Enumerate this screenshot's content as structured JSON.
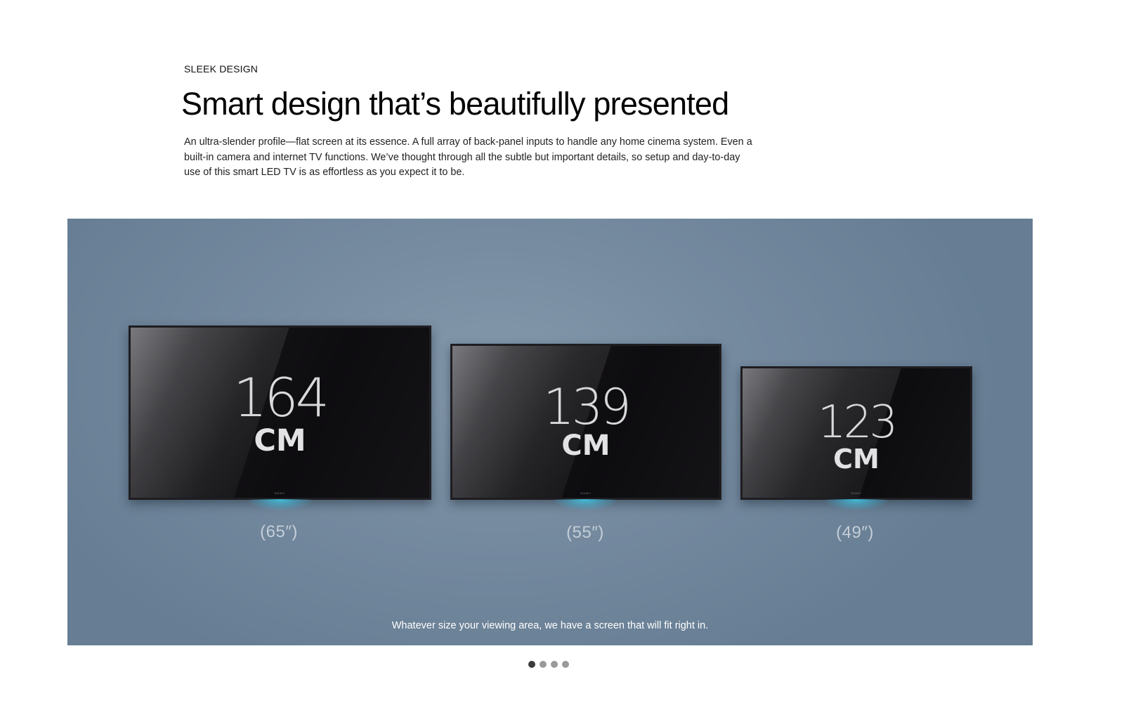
{
  "section": {
    "eyebrow": "SLEEK DESIGN",
    "headline": "Smart design that’s beautifully presented",
    "body": "An ultra-slender profile—flat screen at its essence. A full array of back-panel inputs to handle any home cinema system. Even a built-in camera and internet TV functions. We’ve thought through all the subtle but important details, so setup and day-to-day use of this smart LED TV is as effortless as you expect it to be."
  },
  "slide": {
    "tvs": [
      {
        "size": "164",
        "unit": "CM",
        "inches": "(65″)",
        "brand": "SONY"
      },
      {
        "size": "139",
        "unit": "CM",
        "inches": "(55″)",
        "brand": "SONY"
      },
      {
        "size": "123",
        "unit": "CM",
        "inches": "(49″)",
        "brand": "SONY"
      }
    ],
    "caption": "Whatever size your viewing area, we have a screen that will fit right in.",
    "glow_color": "#40c8e6",
    "background_color": "#768ba0"
  },
  "carousel": {
    "slide_count": 4,
    "active_index": 0
  }
}
